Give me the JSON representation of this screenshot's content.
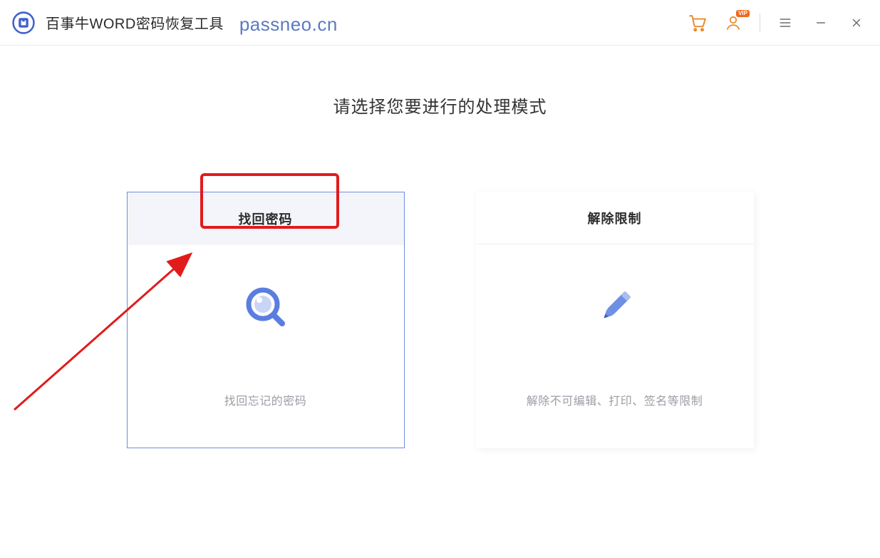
{
  "titlebar": {
    "app_title": "百事牛WORD密码恢复工具",
    "watermark": "passneo.cn",
    "vip_badge": "VIP"
  },
  "main": {
    "prompt": "请选择您要进行的处理模式",
    "cards": [
      {
        "title": "找回密码",
        "desc": "找回忘记的密码"
      },
      {
        "title": "解除限制",
        "desc": "解除不可编辑、打印、签名等限制"
      }
    ]
  }
}
